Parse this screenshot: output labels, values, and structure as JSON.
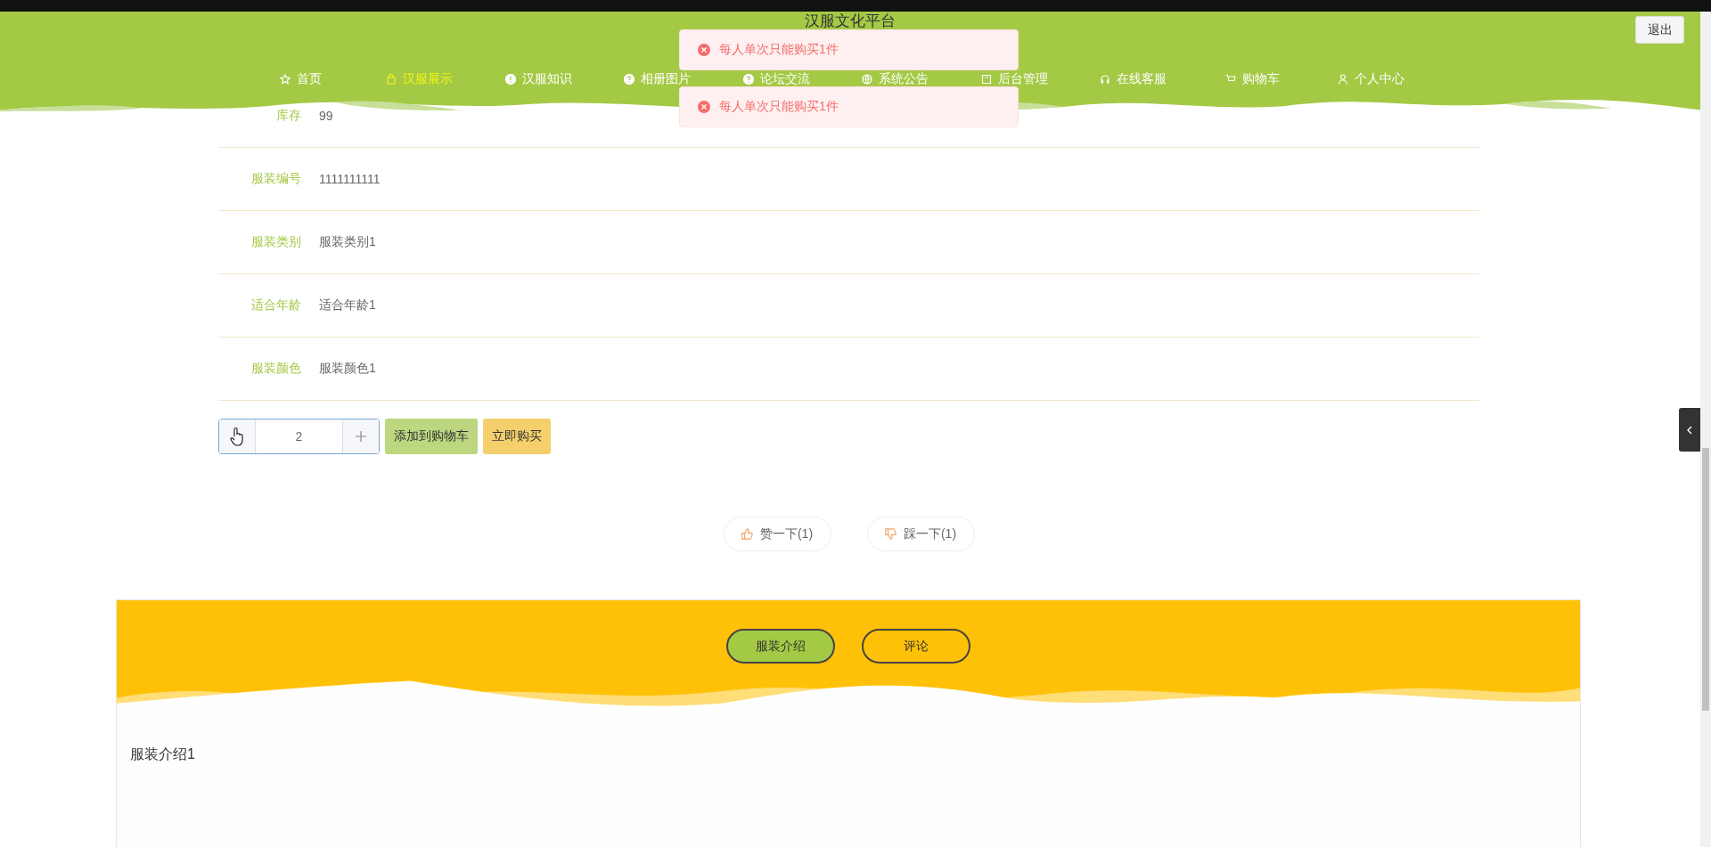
{
  "site_title": "汉服文化平台",
  "logout": "退出",
  "nav": [
    {
      "label": "首页",
      "selected": false
    },
    {
      "label": "汉服展示",
      "selected": true
    },
    {
      "label": "汉服知识",
      "selected": false
    },
    {
      "label": "相册图片",
      "selected": false
    },
    {
      "label": "论坛交流",
      "selected": false
    },
    {
      "label": "系统公告",
      "selected": false
    },
    {
      "label": "后台管理",
      "selected": false
    },
    {
      "label": "在线客服",
      "selected": false
    },
    {
      "label": "购物车",
      "selected": false
    },
    {
      "label": "个人中心",
      "selected": false
    }
  ],
  "toasts": [
    "每人单次只能购买1件",
    "每人单次只能购买1件"
  ],
  "details": [
    {
      "label": "库存",
      "value": "99"
    },
    {
      "label": "服装编号",
      "value": "1111111111"
    },
    {
      "label": "服装类别",
      "value": "服装类别1"
    },
    {
      "label": "适合年龄",
      "value": "适合年龄1"
    },
    {
      "label": "服装颜色",
      "value": "服装颜色1"
    }
  ],
  "quantity": "2",
  "add_to_cart": "添加到购物车",
  "buy_now": "立即购买",
  "votes": [
    {
      "kind": "up",
      "label": "赞一下(1)"
    },
    {
      "kind": "down",
      "label": "踩一下(1)"
    }
  ],
  "tabs": [
    {
      "label": "服装介绍",
      "selected": true
    },
    {
      "label": "评论",
      "selected": false
    }
  ],
  "intro": "服装介绍1"
}
